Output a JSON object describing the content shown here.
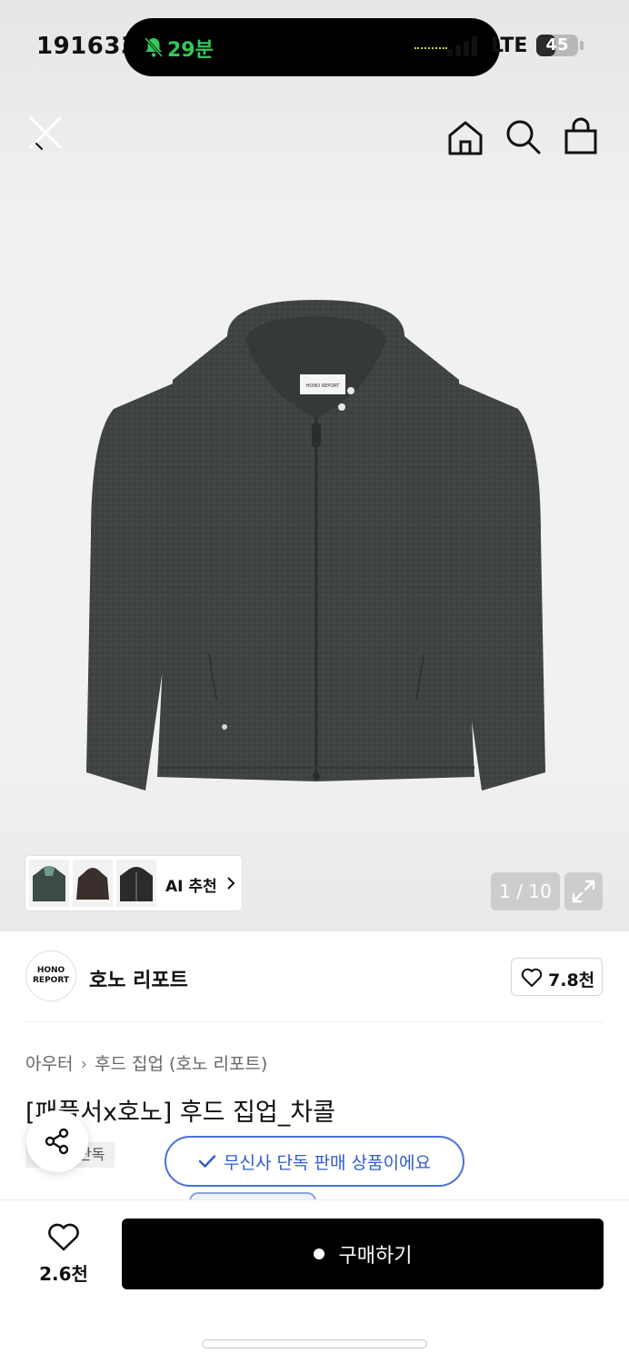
{
  "status_bar": {
    "time": "1916333",
    "notification_text": "29분",
    "network": "LTE",
    "battery_level": "45",
    "battery_fraction": 0.45
  },
  "nav": {
    "close_icon": "close-icon",
    "home_icon": "home-icon",
    "search_icon": "search-icon",
    "bag_icon": "shopping-bag-icon"
  },
  "gallery": {
    "ai_recommend_label": "AI 추천",
    "page_counter": "1 / 10",
    "thumbnail_colors": [
      "#3d4a46",
      "#3a2f2c",
      "#2b2b2d"
    ]
  },
  "brand": {
    "logo_line1": "HONO",
    "logo_line2": "REPORT",
    "name": "호노 리포트",
    "like_count": "7.8천"
  },
  "product": {
    "breadcrumb_category": "아우터",
    "breadcrumb_subcategory": "후드 집업 (호노 리포트)",
    "title": "[패플서x호노] 후드 집업_차콜",
    "exclusive_tag": "단독",
    "exclusive_notice": "무신사 단독 판매 상품이에요"
  },
  "bottom_bar": {
    "wish_count": "2.6천",
    "buy_label": "구매하기"
  },
  "colors": {
    "accent_blue": "#2f5bd3",
    "buy_button": "#000000",
    "garment": "#3f4442"
  }
}
